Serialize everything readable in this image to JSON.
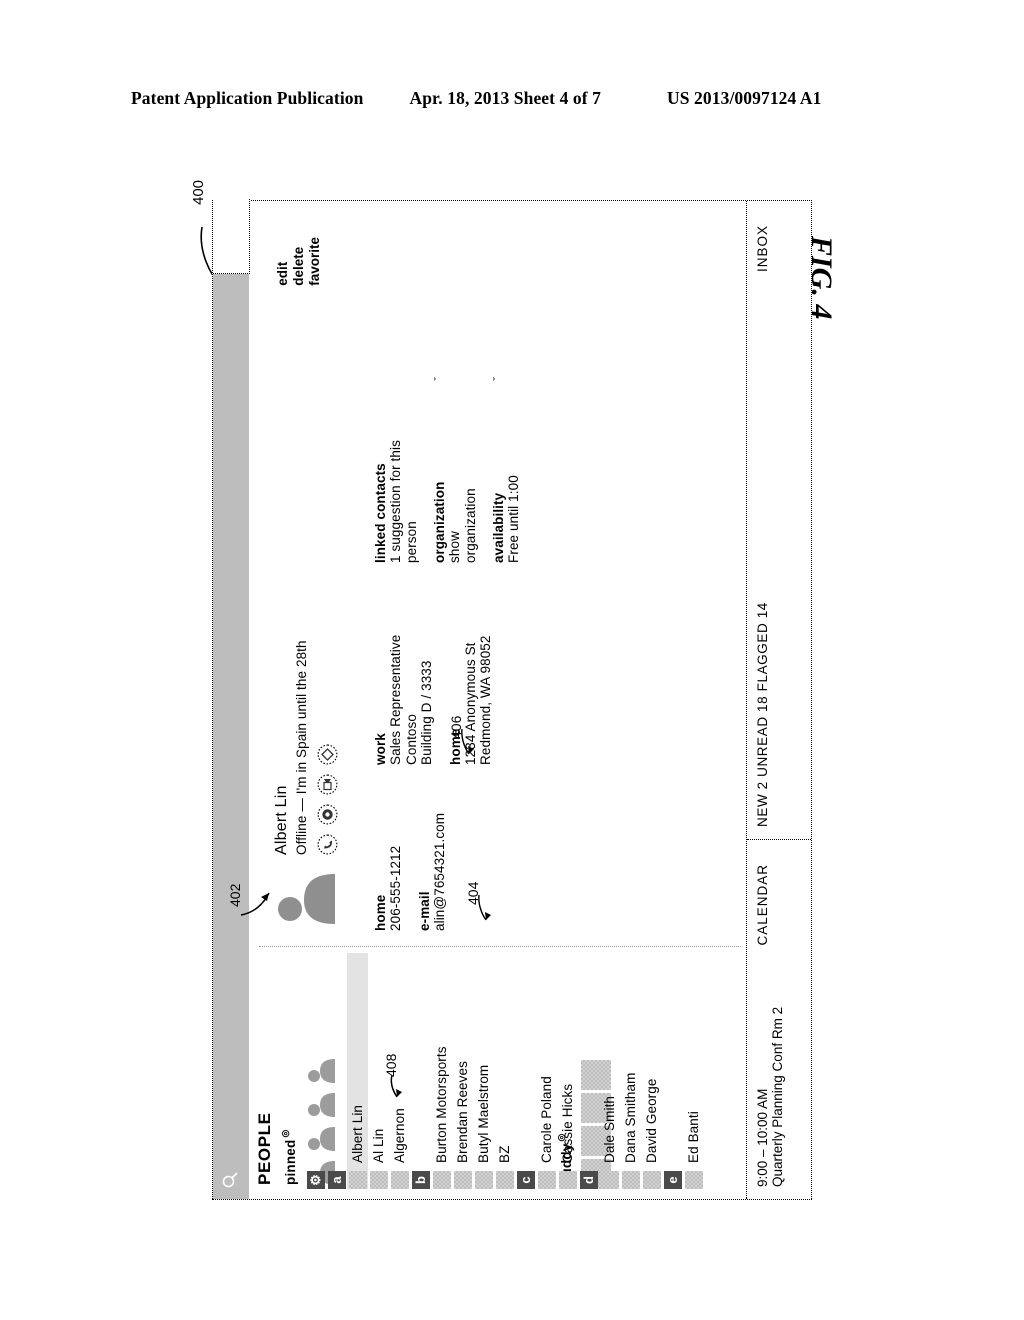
{
  "page_header": {
    "publication": "Patent Application Publication",
    "date_sheet": "Apr. 18, 2013  Sheet 4 of 7",
    "patent_number": "US 2013/0097124 A1"
  },
  "figure": {
    "caption": "FIG. 4",
    "ref_window": "400",
    "ref_detail_pane": "402",
    "ref_home_field": "404",
    "ref_home_address": "406",
    "ref_selected_contact": "408"
  },
  "app": {
    "search_icon": "search-icon",
    "people_title": "PEOPLE",
    "groups": [
      {
        "label": "pinned",
        "icon": "pin-badge-icon",
        "tile_count": 4
      },
      {
        "label": "buddy",
        "icon": "buddy-badge-icon",
        "tile_count": 4
      }
    ],
    "contacts": [
      {
        "type": "header",
        "letter": "⚙"
      },
      {
        "type": "header",
        "letter": "a"
      },
      {
        "type": "contact",
        "name": "Albert Lin",
        "selected": true
      },
      {
        "type": "contact",
        "name": "Al Lin"
      },
      {
        "type": "contact",
        "name": "Algernon"
      },
      {
        "type": "header",
        "letter": "b"
      },
      {
        "type": "contact",
        "name": "Burton Motorsports"
      },
      {
        "type": "contact",
        "name": "Brendan Reeves"
      },
      {
        "type": "contact",
        "name": "Butyl Maelstrom"
      },
      {
        "type": "contact",
        "name": "BZ"
      },
      {
        "type": "header",
        "letter": "c"
      },
      {
        "type": "contact",
        "name": "Carole Poland"
      },
      {
        "type": "contact",
        "name": "Cassie Hicks"
      },
      {
        "type": "header",
        "letter": "d"
      },
      {
        "type": "contact",
        "name": "Dale Smith"
      },
      {
        "type": "contact",
        "name": "Dana Smitham"
      },
      {
        "type": "contact",
        "name": "David George"
      },
      {
        "type": "header",
        "letter": "e"
      },
      {
        "type": "contact",
        "name": "Ed Banti"
      }
    ],
    "detail": {
      "name": "Albert Lin",
      "status": "Offline  —  I'm in Spain until the 28th",
      "quick_icons": [
        "call-icon",
        "message-icon",
        "video-icon",
        "map-icon"
      ],
      "fields_col1": [
        {
          "label": "home",
          "value": "206-555-1212"
        },
        {
          "label": "e-mail",
          "value": "alin@7654321.com"
        }
      ],
      "fields_col2": [
        {
          "label": "work",
          "value": "Sales Representative\nContoso\nBuilding D / 3333"
        },
        {
          "label": "home",
          "value": "1234 Anonymous St\nRedmond, WA  98052"
        }
      ],
      "fields_col3": [
        {
          "label": "linked contacts",
          "value": "1 suggestion for this\nperson",
          "chevron": ""
        },
        {
          "label": "organization",
          "value": "show\norganization",
          "chevron": "ˇ"
        },
        {
          "label": "availability",
          "value": "Free until 1:00",
          "chevron": "ˇ"
        }
      ],
      "actions": [
        "edit",
        "delete",
        "favorite"
      ]
    },
    "bottom_bar": {
      "calendar_title": "CALENDAR",
      "calendar_time": "9:00 – 10:00 AM",
      "calendar_event": "Quarterly Planning  Conf Rm 2",
      "inbox_title": "INBOX",
      "inbox_counts": "NEW 2   UNREAD 18   FLAGGED 14"
    }
  }
}
